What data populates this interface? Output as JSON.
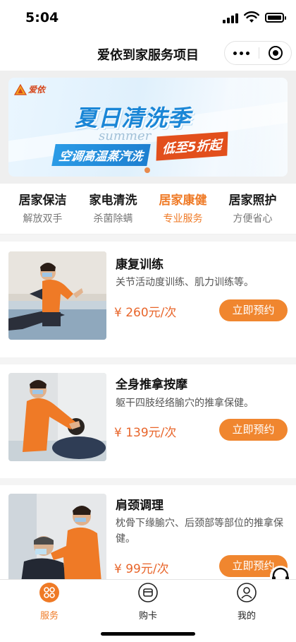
{
  "status_bar": {
    "time": "5:04"
  },
  "nav": {
    "title": "爱依到家服务项目"
  },
  "banner": {
    "brand": "爱依",
    "headline": "夏日清洗季",
    "script": "summer",
    "subline": "空调高温蒸汽洗",
    "discount": "低至5折起"
  },
  "categories": [
    {
      "title": "居家保洁",
      "sub": "解放双手"
    },
    {
      "title": "家电清洗",
      "sub": "杀菌除螨"
    },
    {
      "title": "居家康健",
      "sub": "专业服务"
    },
    {
      "title": "居家照护",
      "sub": "方便省心"
    }
  ],
  "active_category": "居家康健",
  "services": [
    {
      "title": "康复训练",
      "desc": "关节活动度训练、肌力训练等。",
      "price": "¥ 260元/次",
      "button": "立即预约"
    },
    {
      "title": "全身推拿按摩",
      "desc": "躯干四肢经络腧穴的推拿保健。",
      "price": "¥ 139元/次",
      "button": "立即预约"
    },
    {
      "title": "肩颈调理",
      "desc": "枕骨下缘腧穴、后颈部等部位的推拿保健。",
      "price": "¥ 99元/次",
      "button": "立即预约"
    }
  ],
  "float_service": {
    "label": "客服",
    "icon": "headset-icon"
  },
  "tab_bar": [
    {
      "label": "服务",
      "icon": "grid-icon",
      "active": true
    },
    {
      "label": "购卡",
      "icon": "card-icon",
      "active": false
    },
    {
      "label": "我的",
      "icon": "user-icon",
      "active": false
    }
  ],
  "colors": {
    "accent": "#ef7a26",
    "price": "#e8652a",
    "button": "#f0862f",
    "banner_blue": "#1a86d6",
    "banner_red": "#e24f1c"
  }
}
